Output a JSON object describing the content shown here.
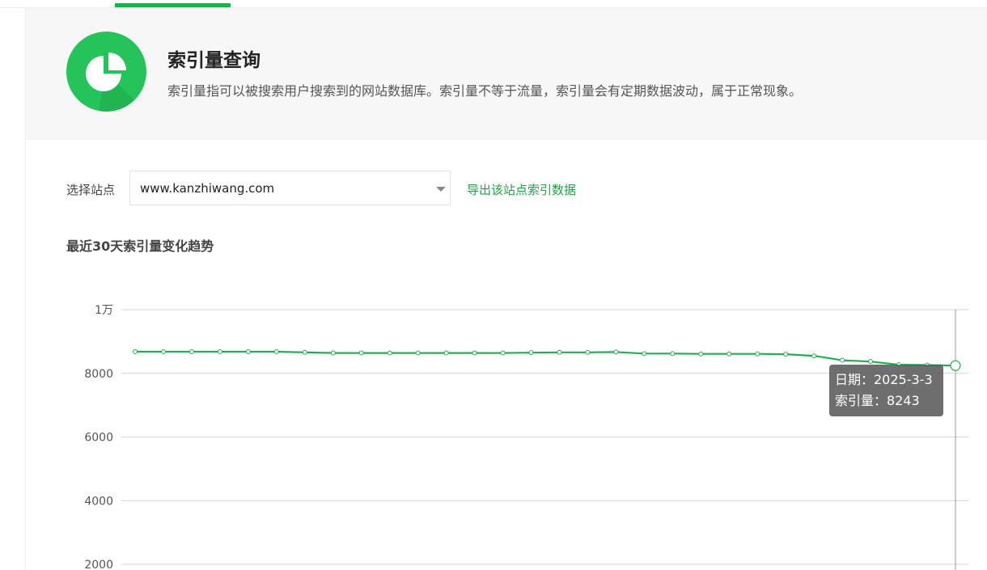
{
  "header": {
    "title": "索引量查询",
    "description": "索引量指可以被搜索用户搜索到的网站数据库。索引量不等于流量，索引量会有定期数据波动，属于正常现象。"
  },
  "site_selector": {
    "label": "选择站点",
    "selected": "www.kanzhiwang.com",
    "export_link": "导出该站点索引数据"
  },
  "section": {
    "title": "最近30天索引量变化趋势"
  },
  "colors": {
    "accent": "#22b04f",
    "line": "#22b04f"
  },
  "chart_data": {
    "type": "line",
    "y_tick_labels": [
      "1万",
      "8000",
      "6000",
      "4000",
      "2000"
    ],
    "y_tick_values": [
      10000,
      8000,
      6000,
      4000,
      2000
    ],
    "ylim": [
      2000,
      10000
    ],
    "grid": true,
    "series": [
      {
        "values": [
          8680,
          8680,
          8680,
          8680,
          8680,
          8680,
          8660,
          8640,
          8640,
          8640,
          8640,
          8640,
          8640,
          8640,
          8650,
          8660,
          8660,
          8670,
          8620,
          8620,
          8610,
          8610,
          8610,
          8600,
          8550,
          8410,
          8370,
          8270,
          8260,
          8243
        ]
      }
    ],
    "tooltip": {
      "date_label": "日期：2025-3-3",
      "value_label": "索引量：8243"
    }
  }
}
